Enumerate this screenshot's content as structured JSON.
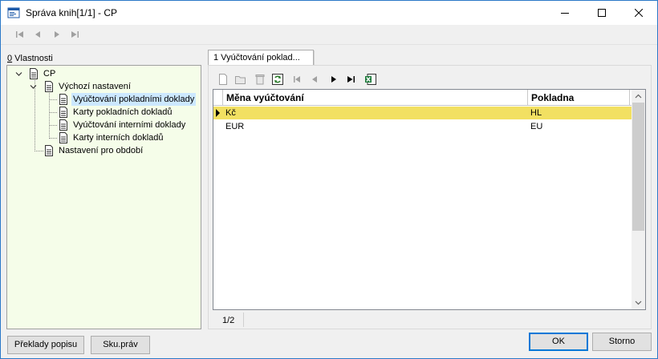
{
  "window": {
    "title": "Správa knih[1/1] - CP"
  },
  "left_panel": {
    "label_prefix": "0",
    "label_rest": " Vlastnosti",
    "tree": {
      "root": "CP",
      "group": "Výchozí nastavení",
      "children": [
        "Vyúčtování pokladními doklady",
        "Karty pokladních dokladů",
        "Vyúčtování interními doklady",
        "Karty interních dokladů"
      ],
      "sibling": "Nastavení pro období"
    },
    "buttons": {
      "translations": "Překlady popisu",
      "rights": "Sku.práv"
    }
  },
  "right_panel": {
    "tab": "1 Vyúčtování poklad...",
    "grid": {
      "columns": [
        "Měna vyúčtování",
        "Pokladna"
      ],
      "rows": [
        [
          "Kč",
          "HL"
        ],
        [
          "EUR",
          "EU"
        ]
      ]
    },
    "status": "1/2"
  },
  "footer": {
    "ok": "OK",
    "cancel": "Storno"
  }
}
